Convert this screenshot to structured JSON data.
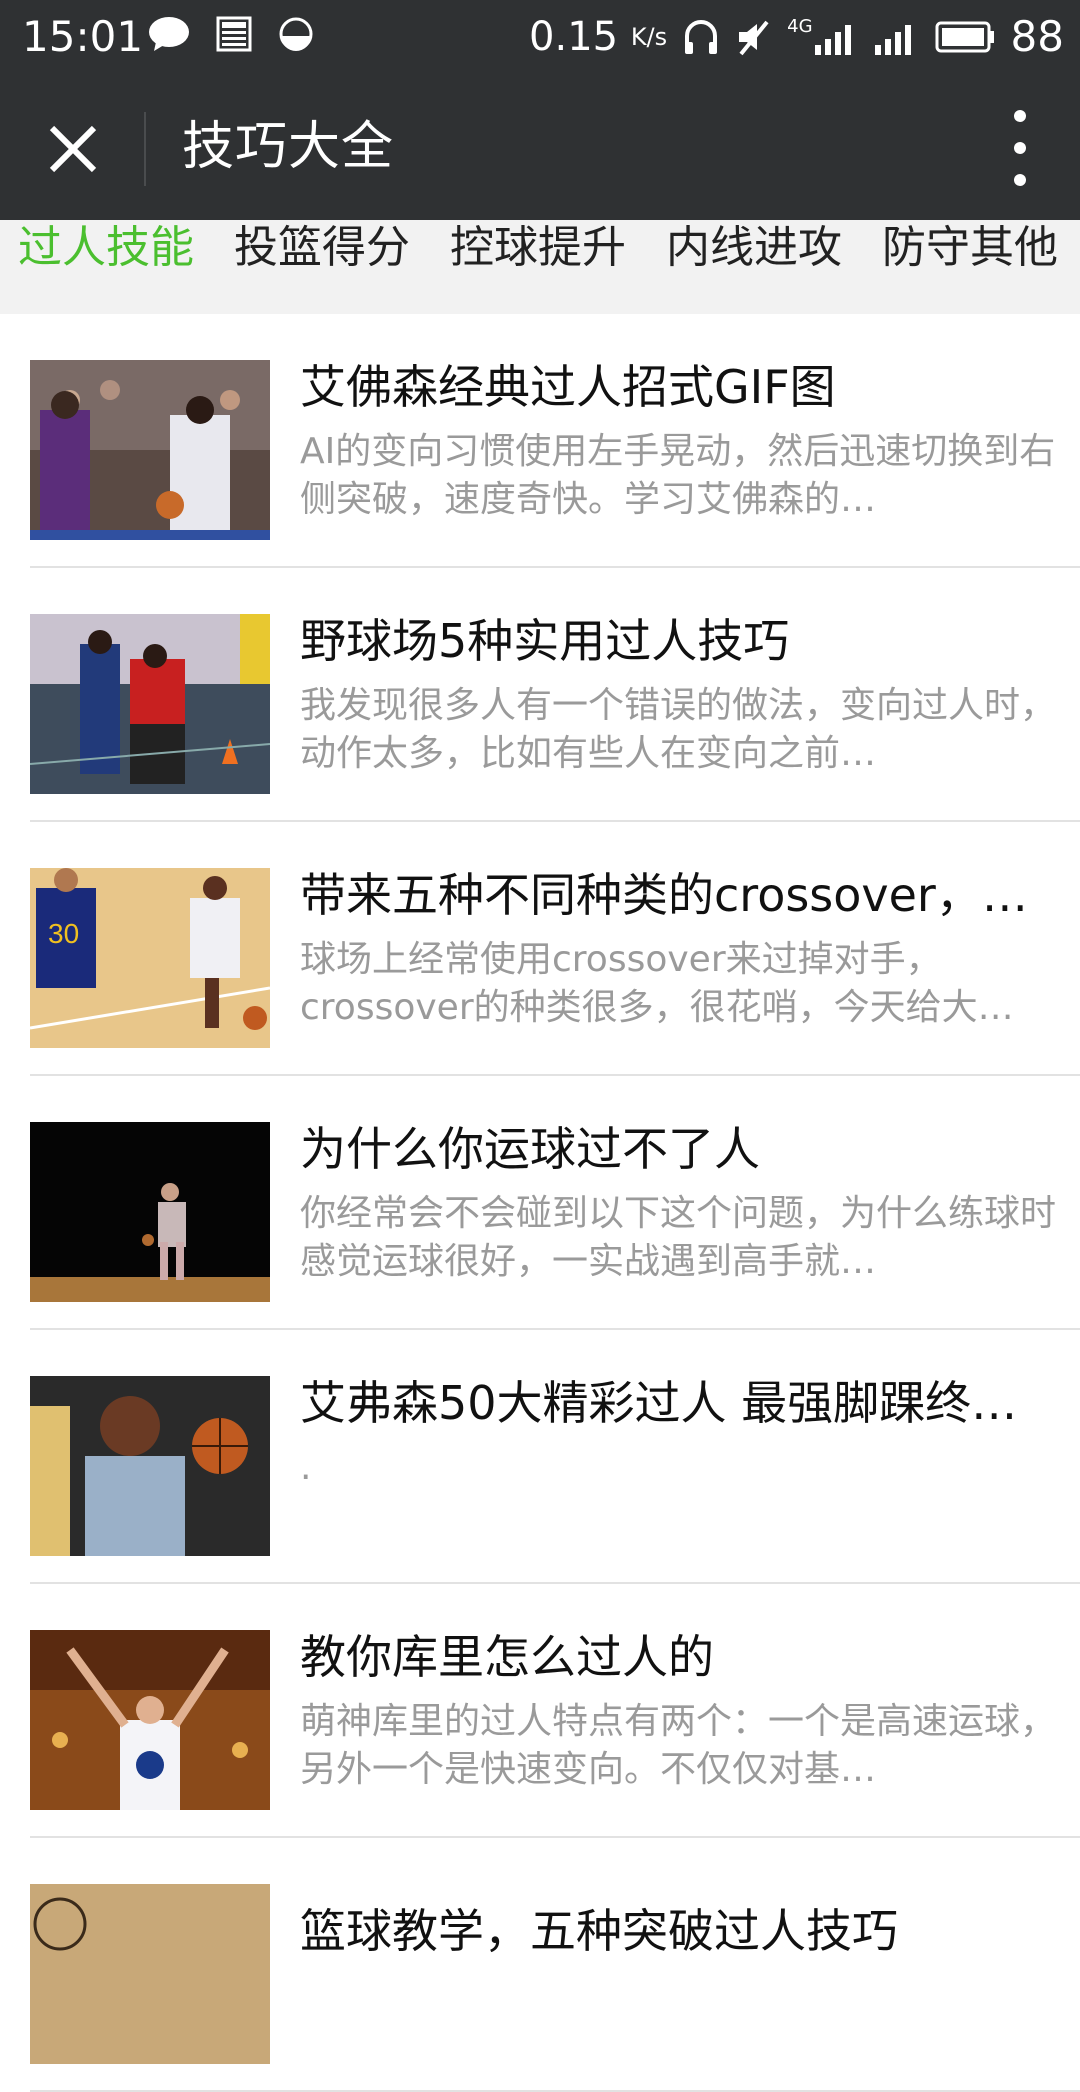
{
  "status": {
    "time": "15:01",
    "speed_value": "0.15",
    "speed_unit": "K/s",
    "network": "4G",
    "battery": "88"
  },
  "header": {
    "title": "技巧大全"
  },
  "tabs": [
    {
      "label": "过人技能",
      "active": true
    },
    {
      "label": "投篮得分",
      "active": false
    },
    {
      "label": "控球提升",
      "active": false
    },
    {
      "label": "内线进攻",
      "active": false
    },
    {
      "label": "防守其他",
      "active": false
    }
  ],
  "articles": [
    {
      "title": "艾佛森经典过人招式GIF图",
      "desc": "AI的变向习惯使用左手晃动，然后迅速切换到右侧突破，速度奇快。学习艾佛森的…"
    },
    {
      "title": "野球场5种实用过人技巧",
      "desc": "我发现很多人有一个错误的做法，变向过人时，动作太多，比如有些人在变向之前…"
    },
    {
      "title": "带来五种不同种类的crossover，…",
      "desc": "球场上经常使用crossover来过掉对手，crossover的种类很多，很花哨，今天给大…"
    },
    {
      "title": "为什么你运球过不了人",
      "desc": "你经常会不会碰到以下这个问题，为什么练球时感觉运球很好，一实战遇到高手就…"
    },
    {
      "title": "艾弗森50大精彩过人 最强脚踝终…",
      "desc": "."
    },
    {
      "title": "教你库里怎么过人的",
      "desc": "萌神库里的过人特点有两个：一个是高速运球，另外一个是快速变向。不仅仅对基…"
    },
    {
      "title": "篮球教学，五种突破过人技巧",
      "desc": ""
    }
  ],
  "colors": {
    "bar": "#2f3133",
    "accent": "#4bbf2f",
    "tab_bg": "#f2f2f2",
    "desc": "#9a9a9a"
  }
}
